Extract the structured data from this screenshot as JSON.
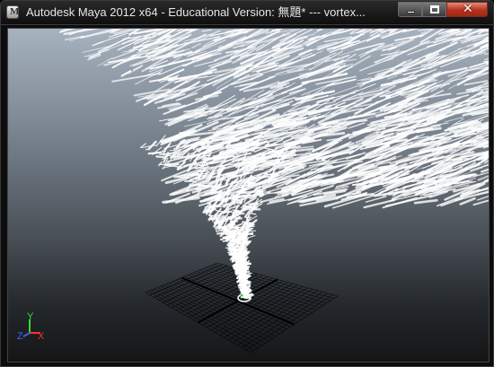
{
  "window": {
    "title": "Autodesk Maya 2012 x64 - Educational Version: 無題*    ---    vortex..."
  },
  "titlebar": {
    "app_icon": "maya-icon",
    "buttons": [
      "minimize-icon",
      "maximize-icon",
      "close-icon"
    ]
  },
  "viewport": {
    "scene": "particle vortex over grid",
    "axis_labels": {
      "x": "X",
      "y": "Y",
      "z": "Z"
    },
    "colors": {
      "x_axis": "#ff3030",
      "y_axis": "#30e030",
      "z_axis": "#4060ff",
      "grid": "#000000",
      "particles": "#ffffff"
    }
  }
}
